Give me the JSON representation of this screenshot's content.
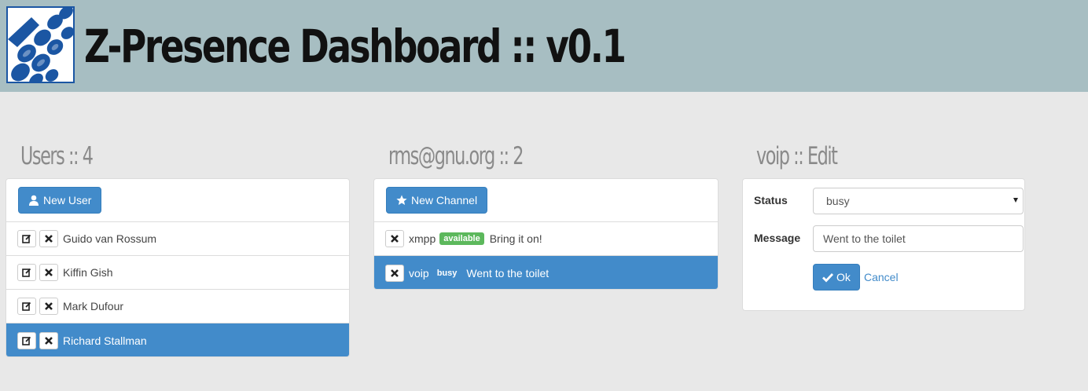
{
  "header": {
    "title": "Z-Presence Dashboard :: v0.1",
    "logo_icon": "z-presence-logo",
    "background": "#a7bec2"
  },
  "users_column": {
    "title": "Users :: 4",
    "new_user_label": "New User",
    "users": [
      {
        "name": "Guido van Rossum",
        "active": false
      },
      {
        "name": "Kiffin Gish",
        "active": false
      },
      {
        "name": "Mark Dufour",
        "active": false
      },
      {
        "name": "Richard Stallman",
        "active": true
      }
    ]
  },
  "channels_column": {
    "title": "rms@gnu.org :: 2",
    "new_channel_label": "New Channel",
    "channels": [
      {
        "name": "xmpp",
        "status": "available",
        "message": "Bring it on!",
        "active": false
      },
      {
        "name": "voip",
        "status": "busy",
        "message": "Went to the toilet",
        "active": true
      }
    ]
  },
  "edit_column": {
    "title": "voip :: Edit",
    "status_label": "Status",
    "status_value": "busy",
    "message_label": "Message",
    "message_value": "Went to the toilet",
    "ok_label": "Ok",
    "cancel_label": "Cancel"
  },
  "colors": {
    "primary": "#428bca",
    "available": "#5cb85c"
  }
}
